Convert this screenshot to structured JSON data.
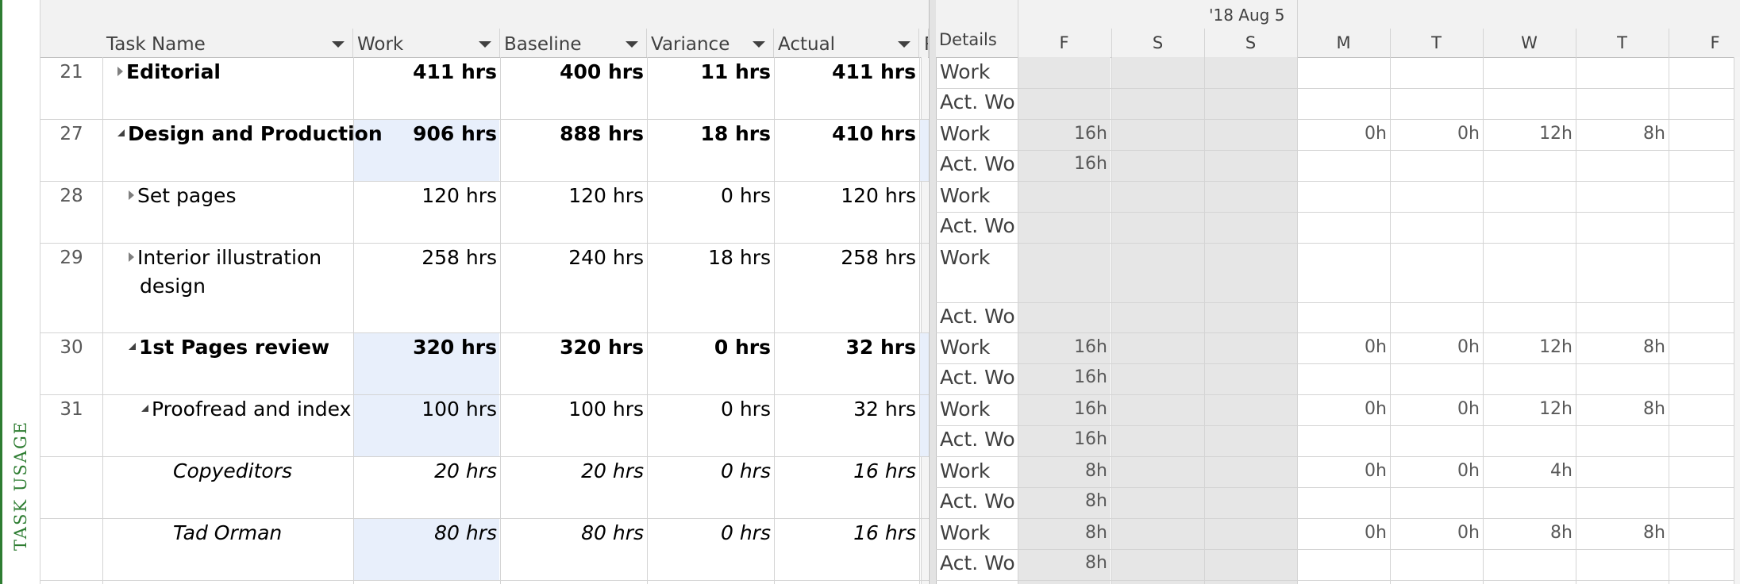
{
  "view_label": "TASK USAGE",
  "columns": {
    "task_name": "Task Name",
    "work": "Work",
    "baseline": "Baseline",
    "variance": "Variance",
    "actual": "Actual",
    "truncated": "R"
  },
  "timescale": {
    "details_header": "Details",
    "week_label": "'18 Aug 5",
    "days": [
      "F",
      "S",
      "S",
      "M",
      "T",
      "W",
      "T",
      "F"
    ]
  },
  "rows": [
    {
      "id": "21",
      "name": "Editorial",
      "style": "summary",
      "indent": 0,
      "expand": "collapsed",
      "work": "411 hrs",
      "baseline": "400 hrs",
      "variance": "11 hrs",
      "actual": "411 hrs",
      "work_ts": [
        "",
        "",
        "",
        "",
        "",
        "",
        "",
        ""
      ],
      "act_ts": [
        "",
        "",
        "",
        "",
        "",
        "",
        "",
        ""
      ]
    },
    {
      "id": "27",
      "name": "Design and Production",
      "style": "summary",
      "indent": 0,
      "expand": "expanded",
      "work": "906 hrs",
      "baseline": "888 hrs",
      "variance": "18 hrs",
      "actual": "410 hrs",
      "work_ts": [
        "16h",
        "",
        "",
        "0h",
        "0h",
        "12h",
        "8h",
        ""
      ],
      "act_ts": [
        "16h",
        "",
        "",
        "",
        "",
        "",
        "",
        ""
      ]
    },
    {
      "id": "28",
      "name": "Set pages",
      "style": "task",
      "indent": 1,
      "expand": "collapsed",
      "work": "120 hrs",
      "baseline": "120 hrs",
      "variance": "0 hrs",
      "actual": "120 hrs",
      "work_ts": [
        "",
        "",
        "",
        "",
        "",
        "",
        "",
        ""
      ],
      "act_ts": [
        "",
        "",
        "",
        "",
        "",
        "",
        "",
        ""
      ]
    },
    {
      "id": "29",
      "name": "Interior illustration",
      "name2": "design",
      "style": "task",
      "indent": 1,
      "expand": "collapsed",
      "work": "258 hrs",
      "baseline": "240 hrs",
      "variance": "18 hrs",
      "actual": "258 hrs",
      "work_ts": [
        "",
        "",
        "",
        "",
        "",
        "",
        "",
        ""
      ],
      "act_ts": [
        "",
        "",
        "",
        "",
        "",
        "",
        "",
        ""
      ]
    },
    {
      "id": "30",
      "name": "1st Pages review",
      "style": "summary",
      "indent": 1,
      "expand": "expanded",
      "work": "320 hrs",
      "baseline": "320 hrs",
      "variance": "0 hrs",
      "actual": "32 hrs",
      "work_ts": [
        "16h",
        "",
        "",
        "0h",
        "0h",
        "12h",
        "8h",
        ""
      ],
      "act_ts": [
        "16h",
        "",
        "",
        "",
        "",
        "",
        "",
        ""
      ]
    },
    {
      "id": "31",
      "name": "Proofread and index",
      "style": "task",
      "indent": 2,
      "expand": "expanded",
      "work": "100 hrs",
      "baseline": "100 hrs",
      "variance": "0 hrs",
      "actual": "32 hrs",
      "work_ts": [
        "16h",
        "",
        "",
        "0h",
        "0h",
        "12h",
        "8h",
        ""
      ],
      "act_ts": [
        "16h",
        "",
        "",
        "",
        "",
        "",
        "",
        ""
      ]
    },
    {
      "id": "",
      "name": "Copyeditors",
      "style": "assignment",
      "indent": 3,
      "expand": "none",
      "work": "20 hrs",
      "baseline": "20 hrs",
      "variance": "0 hrs",
      "actual": "16 hrs",
      "work_ts": [
        "8h",
        "",
        "",
        "0h",
        "0h",
        "4h",
        "",
        ""
      ],
      "act_ts": [
        "8h",
        "",
        "",
        "",
        "",
        "",
        "",
        ""
      ]
    },
    {
      "id": "",
      "name": "Tad Orman",
      "style": "assignment",
      "indent": 3,
      "expand": "none",
      "work": "80 hrs",
      "baseline": "80 hrs",
      "variance": "0 hrs",
      "actual": "16 hrs",
      "work_ts": [
        "8h",
        "",
        "",
        "0h",
        "0h",
        "8h",
        "8h",
        ""
      ],
      "act_ts": [
        "8h",
        "",
        "",
        "",
        "",
        "",
        "",
        ""
      ]
    }
  ],
  "detail_labels": {
    "work": "Work",
    "actual": "Act. Wo"
  },
  "colors": {
    "accent": "#2e7d32",
    "selected_cell": "#e8effb",
    "nonworking": "#e6e6e6"
  }
}
